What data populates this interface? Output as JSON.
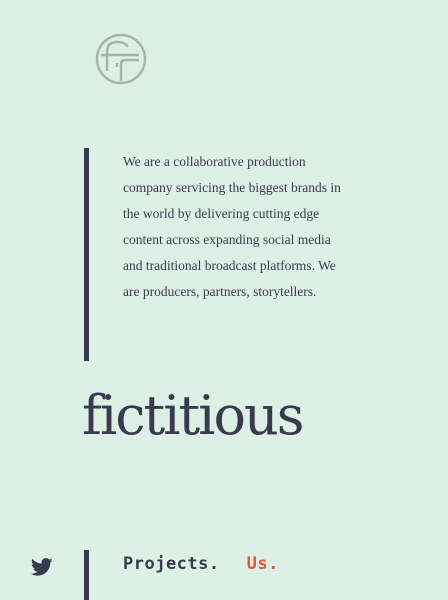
{
  "intro": {
    "text": "We are a collaborative production company servicing the biggest brands in the world by delivering cutting edge content across expanding social media and traditional broadcast platforms. We are producers, partners, storytellers."
  },
  "brand": {
    "wordmark": "fictitious",
    "logo_icon": "fictitious-monogram-icon"
  },
  "social": {
    "twitter_icon": "twitter-icon"
  },
  "nav": {
    "projects": "Projects.",
    "us": "Us."
  },
  "colors": {
    "background": "#dcf0e6",
    "ink": "#3a3a4e",
    "accent": "#e2553a",
    "logo": "#a4b3ad"
  }
}
